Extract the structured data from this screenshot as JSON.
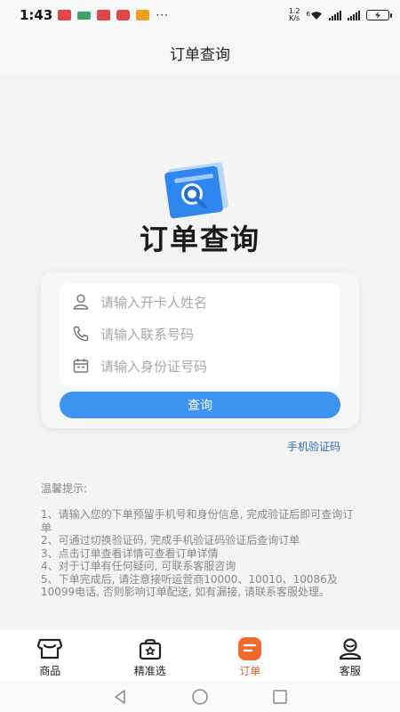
{
  "status_bar": {
    "time": "1:43",
    "more": "···",
    "net_speed_value": "1.2",
    "net_speed_unit": "K/s",
    "wifi_badge": "6",
    "battery_icon": "battery-charging-icon"
  },
  "header": {
    "title": "订单查询"
  },
  "hero": {
    "title": "订单查询",
    "icon": "document-search-icon"
  },
  "form": {
    "name_placeholder": "请输入开卡人姓名",
    "phone_placeholder": "请输入联系号码",
    "id_placeholder": "请输入身份证号码",
    "query_button": "查询"
  },
  "sms_link": "手机验证码",
  "tips": {
    "title": "温馨提示:",
    "items": [
      "1、请输入您的下单预留手机号和身份信息, 完成验证后即可查询订单",
      "2、可通过切换验证码, 完成手机验证码验证后查询订单",
      "3、点击订单查看详情可查看订单详情",
      "4、对于订单有任何疑问, 可联系客服咨询",
      "5、下单完成后, 请注意接听运营商10000、10010、10086及10099电话, 否则影响订单配送, 如有漏接, 请联系客服处理。"
    ]
  },
  "tabs": [
    {
      "label": "商品",
      "icon": "store-icon"
    },
    {
      "label": "精准选",
      "icon": "bag-star-icon"
    },
    {
      "label": "订单",
      "icon": "order-icon"
    },
    {
      "label": "客服",
      "icon": "customer-service-icon"
    }
  ],
  "colors": {
    "accent": "#3c93f0",
    "tab_active": "#f05a28",
    "link": "#2f6bb0"
  }
}
